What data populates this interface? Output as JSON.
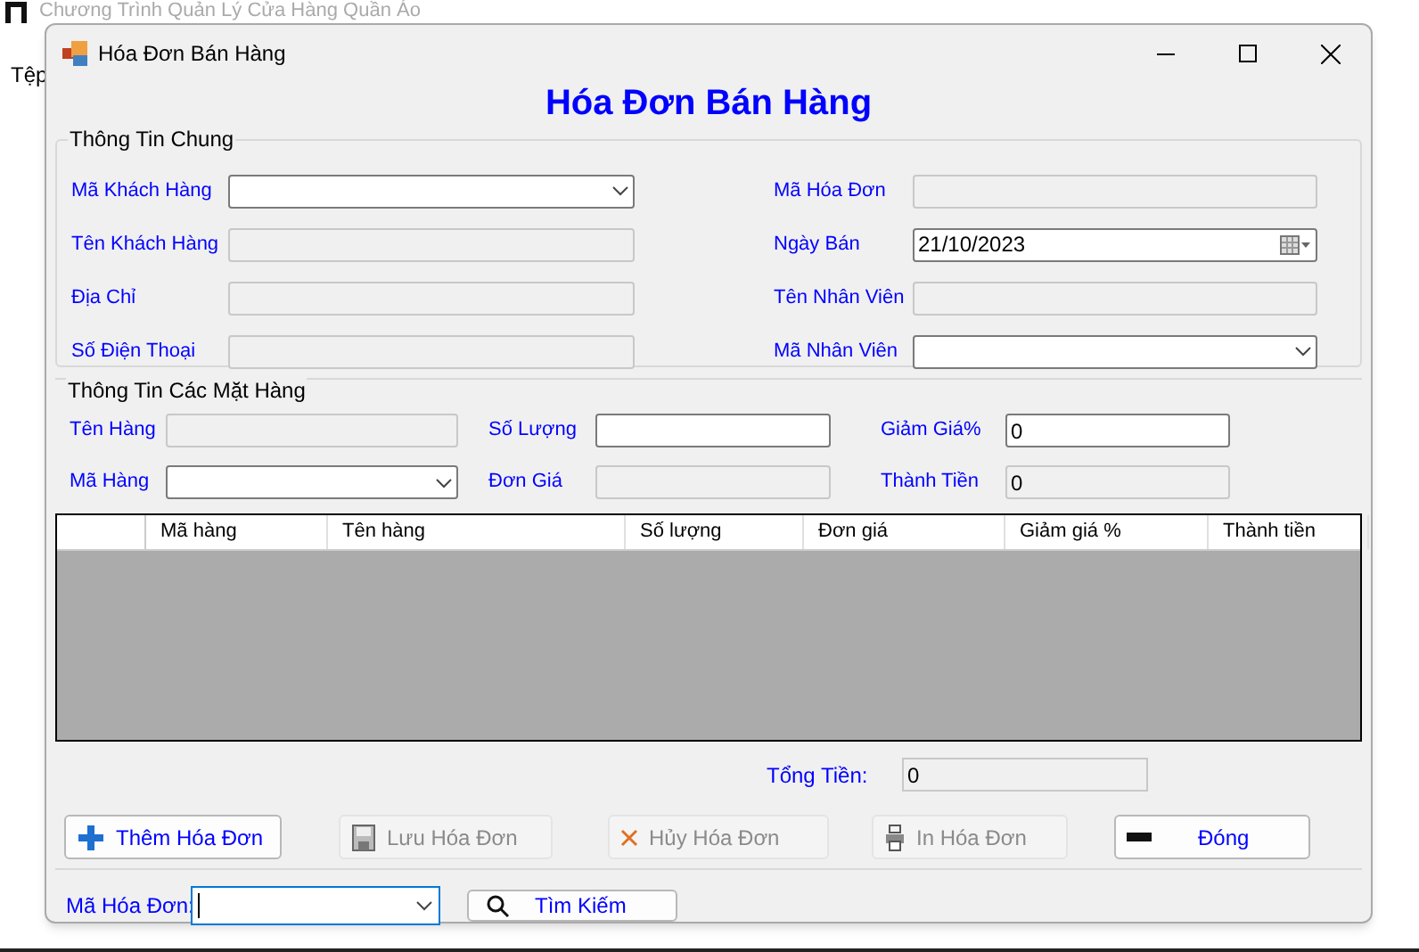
{
  "app": {
    "title": "Chương Trình Quản Lý Cửa Hàng Quần Áo",
    "menu": [
      "Tệp"
    ]
  },
  "dialog": {
    "title": "Hóa Đơn Bán Hàng",
    "heading": "Hóa Đơn Bán Hàng",
    "general": {
      "legend": "Thông Tin Chung",
      "left": [
        {
          "label": "Mã Khách Hàng",
          "kind": "combo",
          "disabled": false
        },
        {
          "label": "Tên Khách Hàng",
          "kind": "text",
          "disabled": true
        },
        {
          "label": "Địa Chỉ",
          "kind": "text",
          "disabled": true
        },
        {
          "label": "Số Điện Thoại",
          "kind": "text",
          "disabled": true
        }
      ],
      "right": [
        {
          "label": "Mã Hóa Đơn",
          "kind": "text",
          "disabled": true
        },
        {
          "label": "Ngày Bán",
          "kind": "date",
          "disabled": false,
          "value": "21/10/2023"
        },
        {
          "label": "Tên Nhân Viên",
          "kind": "text",
          "disabled": true
        },
        {
          "label": "Mã Nhân Viên",
          "kind": "combo",
          "disabled": false
        }
      ]
    },
    "items": {
      "legend": "Thông Tin Các Mặt Hàng",
      "columns": [
        [
          {
            "label": "Tên Hàng",
            "kind": "text",
            "disabled": true
          },
          {
            "label": "Mã Hàng",
            "kind": "combo",
            "disabled": false
          }
        ],
        [
          {
            "label": "Số Lượng",
            "kind": "text",
            "disabled": false
          },
          {
            "label": "Đơn Giá",
            "kind": "text",
            "disabled": true
          }
        ],
        [
          {
            "label": "Giảm Giá%",
            "kind": "text",
            "disabled": false,
            "value": "0"
          },
          {
            "label": "Thành Tiền",
            "kind": "text",
            "disabled": true,
            "value": "0"
          }
        ]
      ]
    },
    "table": {
      "columns": [
        "Mã hàng",
        "Tên hàng",
        "Số lượng",
        "Đơn giá",
        "Giảm giá %",
        "Thành tiền"
      ]
    },
    "total": {
      "label": "Tổng Tiền:",
      "value": "0"
    },
    "buttons": [
      {
        "label": "Thêm Hóa Đơn",
        "kind": "add",
        "disabled": false
      },
      {
        "label": "Lưu Hóa Đơn",
        "kind": "save",
        "disabled": true
      },
      {
        "label": "Hủy Hóa Đơn",
        "kind": "cancel",
        "disabled": true
      },
      {
        "label": "In Hóa Đơn",
        "kind": "print",
        "disabled": true
      },
      {
        "label": "Đóng",
        "kind": "close",
        "disabled": false
      }
    ],
    "search": {
      "label": "Mã Hóa Đơn:",
      "button": "Tìm Kiếm"
    }
  }
}
